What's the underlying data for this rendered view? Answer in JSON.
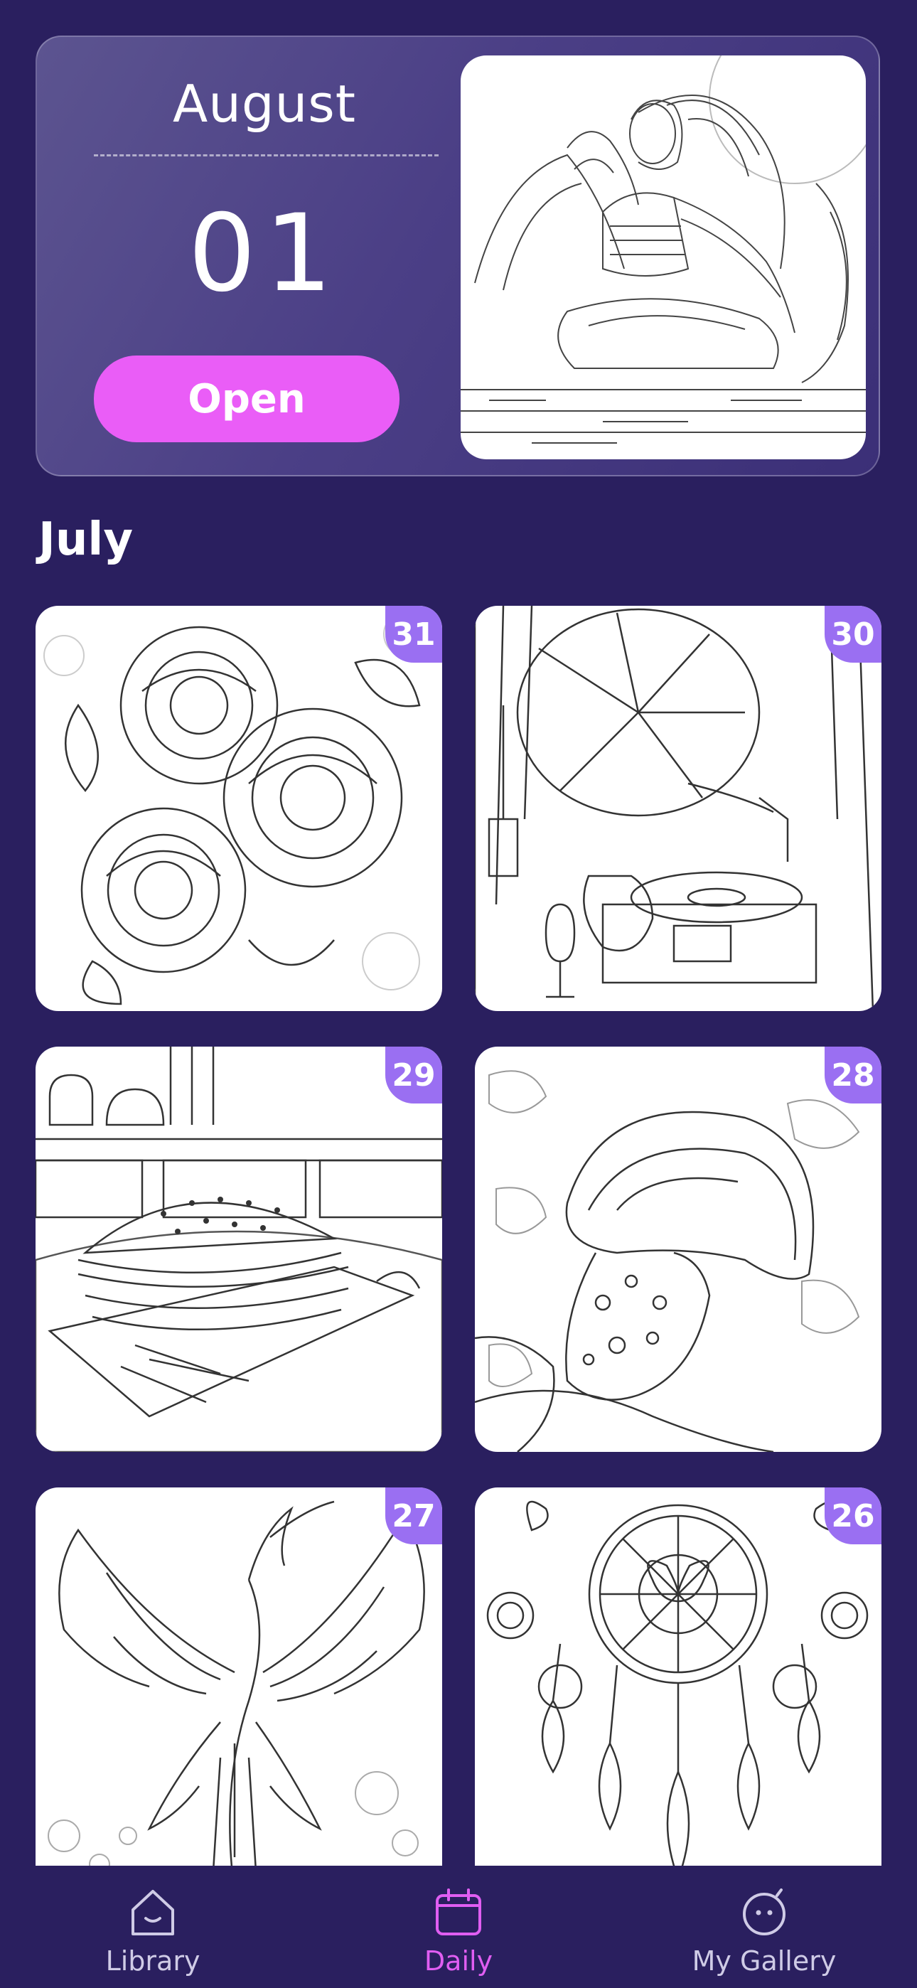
{
  "hero": {
    "month": "August",
    "day": "01",
    "open_label": "Open"
  },
  "section": {
    "title": "July"
  },
  "cards": [
    {
      "day": "31",
      "art": "roses-icon"
    },
    {
      "day": "30",
      "art": "gramophone-icon"
    },
    {
      "day": "29",
      "art": "burger-icon"
    },
    {
      "day": "28",
      "art": "mushroom-icon"
    },
    {
      "day": "27",
      "art": "phoenix-icon"
    },
    {
      "day": "26",
      "art": "dreamcatcher-icon"
    }
  ],
  "nav": {
    "items": [
      {
        "label": "Library",
        "icon": "home-icon"
      },
      {
        "label": "Daily",
        "icon": "calendar-icon"
      },
      {
        "label": "My Gallery",
        "icon": "smiley-icon"
      }
    ],
    "active": "Daily"
  },
  "colors": {
    "background": "#2a1f5f",
    "accent": "#ea5df7",
    "badge": "#9a6ff2",
    "active_nav": "#e05ef2"
  }
}
